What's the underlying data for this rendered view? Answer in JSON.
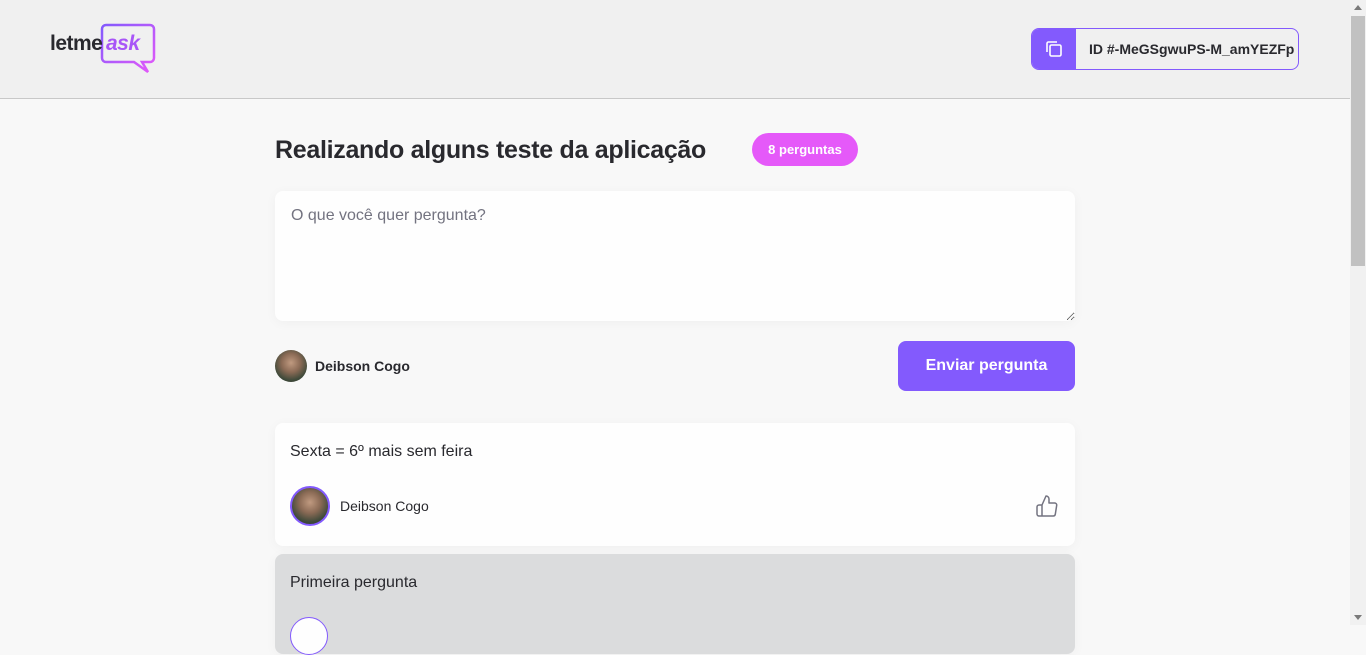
{
  "header": {
    "logo_text_1": "letme",
    "logo_text_2": "ask",
    "room_code_label": "ID #-MeGSgwuPS-M_amYEZFp",
    "copy_icon": "copy-icon"
  },
  "room": {
    "title": "Realizando alguns teste da aplicação",
    "badge": "8 perguntas"
  },
  "form": {
    "placeholder": "O que você quer pergunta?",
    "user_name": "Deibson Cogo",
    "send_label": "Enviar pergunta"
  },
  "questions": [
    {
      "content": "Sexta = 6º mais sem feira",
      "author": "Deibson Cogo",
      "like_icon": "thumbs-up-icon"
    },
    {
      "content": "Primeira pergunta"
    }
  ],
  "colors": {
    "primary": "#835afd",
    "badge": "#e559f9",
    "background": "#f8f8f8",
    "highlighted_question": "#dbdcdd"
  }
}
